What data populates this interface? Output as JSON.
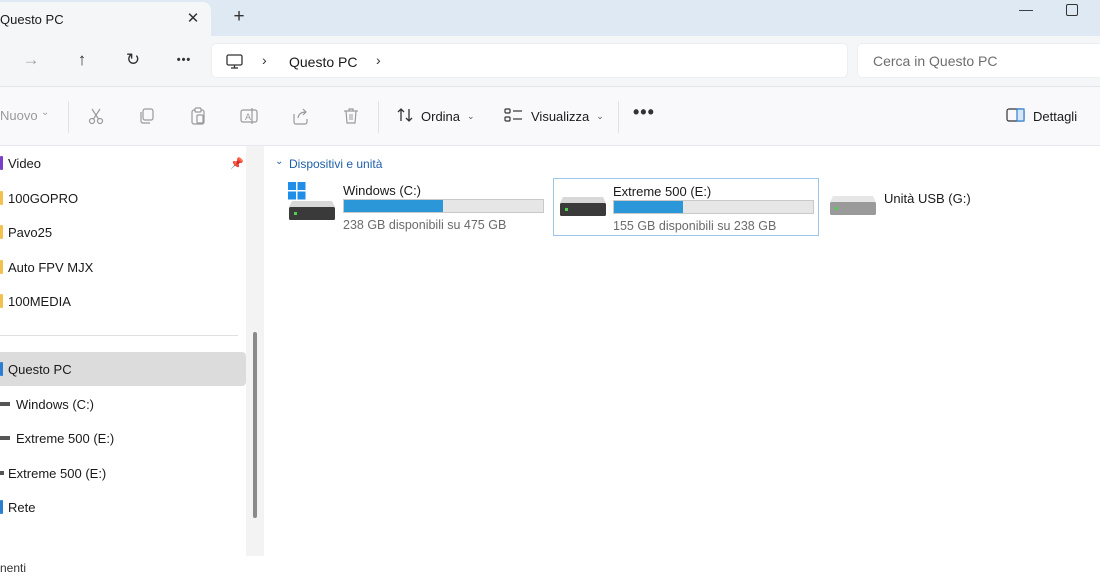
{
  "tab": {
    "title": "Questo PC",
    "close_glyph": "✕",
    "new_glyph": "+"
  },
  "window": {
    "minimize_glyph": "—"
  },
  "nav": {
    "forward_glyph": "→",
    "up_glyph": "↑",
    "refresh_glyph": "↻",
    "more_glyph": "•••",
    "breadcrumb": [
      "Questo PC"
    ],
    "address_icon": "computer-icon",
    "search_placeholder": "Cerca in Questo PC"
  },
  "commands": {
    "new_label": "Nuovo",
    "sort_label": "Ordina",
    "view_label": "Visualizza",
    "more_glyph": "•••",
    "details_label": "Dettagli",
    "icons": [
      "cut-icon",
      "copy-icon",
      "paste-icon",
      "rename-icon",
      "share-icon",
      "delete-icon"
    ]
  },
  "sidebar": {
    "items": [
      {
        "label": "Video",
        "color": "#7a3fc9",
        "pinned": true
      },
      {
        "label": "100GOPRO",
        "color": "#f2c14e"
      },
      {
        "label": "Pavo25",
        "color": "#f2c14e"
      },
      {
        "label": "Auto FPV MJX",
        "color": "#f2c14e"
      },
      {
        "label": "100MEDIA",
        "color": "#f2c14e"
      },
      {
        "label": "Questo PC",
        "color": "#2b7fd1",
        "selected": true
      },
      {
        "label": "Windows (C:)",
        "color": "#555555"
      },
      {
        "label": "Extreme 500 (E:)",
        "color": "#555555"
      },
      {
        "label": "Extreme 500 (E:)",
        "color": "#555555"
      },
      {
        "label": "Rete",
        "color": "#2b7fd1"
      }
    ],
    "bottom_text": "nenti"
  },
  "main": {
    "group_title": "Dispositivi e unità",
    "drives": [
      {
        "name": "Windows (C:)",
        "free_text": "238 GB disponibili su 475 GB",
        "used_fraction": 0.499,
        "icon": "windows-drive-icon"
      },
      {
        "name": "Extreme 500 (E:)",
        "free_text": "155 GB disponibili su 238 GB",
        "used_fraction": 0.349,
        "icon": "hard-drive-icon",
        "selected": true
      },
      {
        "name": "Unità USB (G:)",
        "icon": "usb-drive-icon"
      }
    ]
  },
  "colors": {
    "accent": "#2b97d8",
    "selection": "#dcdcdc",
    "link": "#1f5fa8"
  }
}
